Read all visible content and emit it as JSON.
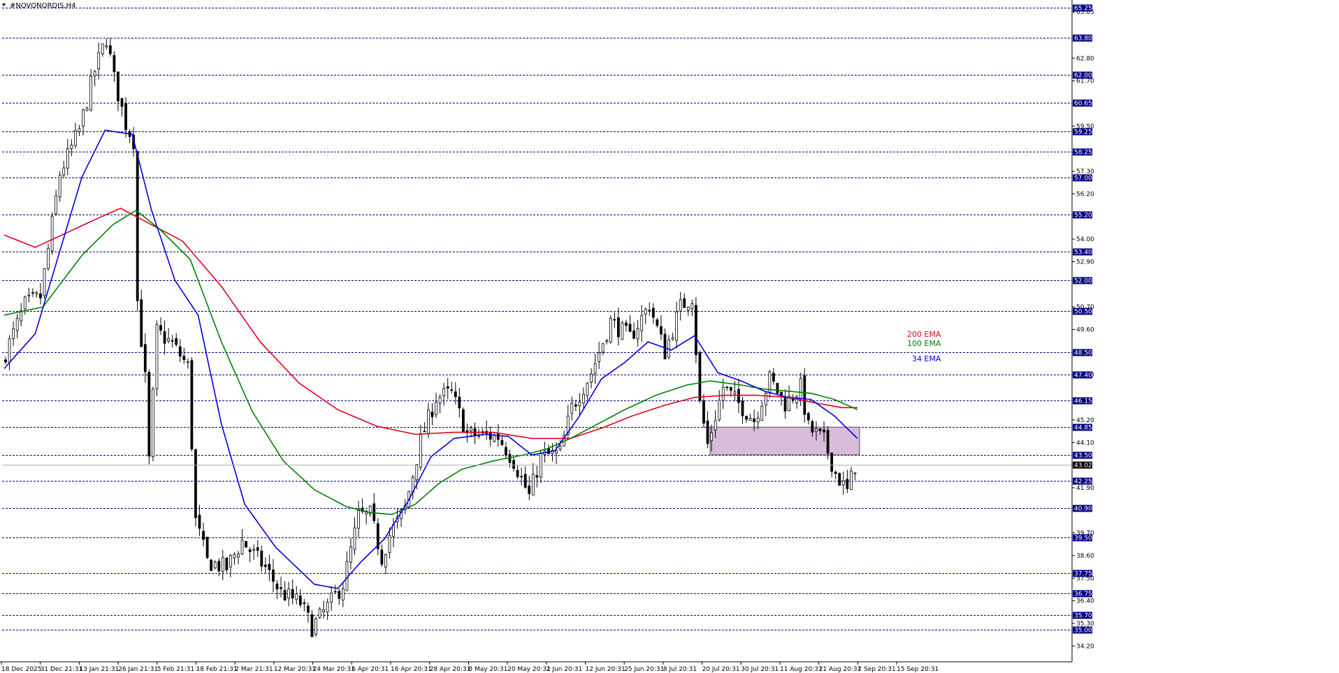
{
  "window": {
    "title": "#NOVONORDIS,H4"
  },
  "chart_data": {
    "type": "candlestick",
    "symbol": "#NOVONORDIS",
    "timeframe": "H4",
    "ylim": [
      33.6,
      65.5
    ],
    "grid": "horizontal dashed at marked levels",
    "price_ticks": [
      65.05,
      62.8,
      61.7,
      59.5,
      57.3,
      56.2,
      54.0,
      52.9,
      50.7,
      49.6,
      47.4,
      45.2,
      44.1,
      41.9,
      39.7,
      38.6,
      37.5,
      36.4,
      35.3,
      34.2
    ],
    "levels": [
      {
        "value": 65.25,
        "label": "65.25"
      },
      {
        "value": 63.8,
        "label": "63.80"
      },
      {
        "value": 62.0,
        "label": "62.00"
      },
      {
        "value": 60.65,
        "label": "60.65"
      },
      {
        "value": 59.25,
        "label": "59.25"
      },
      {
        "value": 58.25,
        "label": "58.25"
      },
      {
        "value": 57.0,
        "label": "57.00"
      },
      {
        "value": 55.2,
        "label": "55.20"
      },
      {
        "value": 53.4,
        "label": "53.40"
      },
      {
        "value": 52.0,
        "label": "52.00"
      },
      {
        "value": 50.5,
        "label": "50.50"
      },
      {
        "value": 48.5,
        "label": "48.50"
      },
      {
        "value": 47.4,
        "label": "47.40"
      },
      {
        "value": 46.15,
        "label": "46.15"
      },
      {
        "value": 44.85,
        "label": "44.85"
      },
      {
        "value": 43.5,
        "label": "43.50"
      },
      {
        "value": 42.25,
        "label": "42.25"
      },
      {
        "value": 40.9,
        "label": "40.90"
      },
      {
        "value": 39.5,
        "label": "39.50"
      },
      {
        "value": 37.75,
        "label": "37.75"
      },
      {
        "value": 36.75,
        "label": "36.75"
      },
      {
        "value": 35.7,
        "label": "35.70"
      },
      {
        "value": 35.0,
        "label": "35.00"
      }
    ],
    "current_price": {
      "value": 43.02,
      "label": "43.02"
    },
    "time_labels": [
      "18 Dec 2025",
      "31 Dec 21:31",
      "13 Jan 21:31",
      "26 Jan 21:31",
      "5 Feb 21:31",
      "18 Feb 21:31",
      "2 Mar 21:31",
      "12 Mar 20:31",
      "24 Mar 20:31",
      "6 Apr 20:31",
      "16 Apr 20:31",
      "28 Apr 20:31",
      "8 May 20:31",
      "20 May 20:31",
      "2 Jun 20:31",
      "12 Jun 20:31",
      "25 Jun 20:31",
      "8 Jul 20:31",
      "20 Jul 20:31",
      "30 Jul 20:31",
      "11 Aug 20:31",
      "21 Aug 20:31",
      "2 Sep 20:31",
      "15 Sep 20:31"
    ],
    "bars_count": 220,
    "price_path": [
      [
        0,
        48.0
      ],
      [
        6,
        50.8
      ],
      [
        10,
        51.2
      ],
      [
        12,
        53.5
      ],
      [
        15,
        57.2
      ],
      [
        20,
        59.3
      ],
      [
        24,
        62.2
      ],
      [
        27,
        63.8
      ],
      [
        29,
        61.8
      ],
      [
        32,
        59.6
      ],
      [
        34,
        58.8
      ],
      [
        35,
        51.0
      ],
      [
        37,
        47.2
      ],
      [
        38,
        43.2
      ],
      [
        40,
        49.5
      ],
      [
        44,
        48.9
      ],
      [
        48,
        47.8
      ],
      [
        50,
        40.3
      ],
      [
        53,
        38.3
      ],
      [
        58,
        38.0
      ],
      [
        62,
        39.3
      ],
      [
        68,
        38.0
      ],
      [
        72,
        36.8
      ],
      [
        77,
        36.3
      ],
      [
        80,
        35.1
      ],
      [
        84,
        36.1
      ],
      [
        88,
        37.2
      ],
      [
        92,
        40.5
      ],
      [
        95,
        40.6
      ],
      [
        98,
        38.5
      ],
      [
        100,
        39.6
      ],
      [
        104,
        40.9
      ],
      [
        108,
        44.2
      ],
      [
        112,
        46.3
      ],
      [
        116,
        46.5
      ],
      [
        120,
        44.5
      ],
      [
        128,
        44.4
      ],
      [
        132,
        43.2
      ],
      [
        136,
        41.5
      ],
      [
        139,
        43.4
      ],
      [
        144,
        43.6
      ],
      [
        147,
        45.8
      ],
      [
        152,
        47.5
      ],
      [
        157,
        50.0
      ],
      [
        162,
        49.2
      ],
      [
        167,
        50.8
      ],
      [
        171,
        48.5
      ],
      [
        175,
        50.7
      ],
      [
        178,
        51.2
      ],
      [
        180,
        46.0
      ],
      [
        182,
        44.0
      ],
      [
        186,
        46.8
      ],
      [
        190,
        46.0
      ],
      [
        194,
        45.2
      ],
      [
        198,
        47.2
      ],
      [
        202,
        46.0
      ],
      [
        206,
        46.8
      ],
      [
        208,
        44.8
      ],
      [
        212,
        44.2
      ],
      [
        215,
        42.6
      ],
      [
        218,
        41.7
      ],
      [
        220,
        43.0
      ]
    ],
    "ema_path_points": {
      "ema34": [
        [
          0,
          47.7
        ],
        [
          8,
          49.4
        ],
        [
          14,
          53.2
        ],
        [
          20,
          57.0
        ],
        [
          26,
          59.3
        ],
        [
          33,
          59.1
        ],
        [
          38,
          55.4
        ],
        [
          44,
          52.0
        ],
        [
          50,
          50.3
        ],
        [
          56,
          45.0
        ],
        [
          62,
          41.1
        ],
        [
          70,
          39.0
        ],
        [
          80,
          37.2
        ],
        [
          86,
          37.0
        ],
        [
          92,
          38.3
        ],
        [
          98,
          39.4
        ],
        [
          104,
          41.2
        ],
        [
          110,
          43.4
        ],
        [
          116,
          44.3
        ],
        [
          124,
          44.5
        ],
        [
          130,
          44.4
        ],
        [
          136,
          43.5
        ],
        [
          142,
          43.7
        ],
        [
          148,
          45.3
        ],
        [
          154,
          47.2
        ],
        [
          160,
          48.0
        ],
        [
          166,
          49.0
        ],
        [
          172,
          48.6
        ],
        [
          178,
          49.3
        ],
        [
          184,
          47.5
        ],
        [
          190,
          47.1
        ],
        [
          196,
          46.6
        ],
        [
          202,
          46.3
        ],
        [
          208,
          46.2
        ],
        [
          214,
          45.4
        ],
        [
          220,
          44.3
        ]
      ],
      "ema100": [
        [
          0,
          50.3
        ],
        [
          10,
          50.7
        ],
        [
          20,
          53.2
        ],
        [
          28,
          54.7
        ],
        [
          34,
          55.4
        ],
        [
          40,
          54.5
        ],
        [
          48,
          53.0
        ],
        [
          56,
          49.0
        ],
        [
          64,
          45.6
        ],
        [
          72,
          43.2
        ],
        [
          80,
          41.8
        ],
        [
          88,
          41.0
        ],
        [
          94,
          40.7
        ],
        [
          100,
          40.6
        ],
        [
          106,
          41.1
        ],
        [
          112,
          42.1
        ],
        [
          118,
          42.8
        ],
        [
          126,
          43.2
        ],
        [
          134,
          43.5
        ],
        [
          140,
          43.8
        ],
        [
          146,
          44.3
        ],
        [
          154,
          45.1
        ],
        [
          160,
          45.7
        ],
        [
          168,
          46.4
        ],
        [
          176,
          46.9
        ],
        [
          182,
          47.1
        ],
        [
          190,
          46.9
        ],
        [
          196,
          46.7
        ],
        [
          202,
          46.6
        ],
        [
          208,
          46.5
        ],
        [
          214,
          46.2
        ],
        [
          220,
          45.7
        ]
      ],
      "ema200": [
        [
          0,
          54.2
        ],
        [
          8,
          53.6
        ],
        [
          16,
          54.3
        ],
        [
          24,
          55.0
        ],
        [
          30,
          55.5
        ],
        [
          38,
          54.7
        ],
        [
          46,
          53.9
        ],
        [
          56,
          51.7
        ],
        [
          66,
          49.0
        ],
        [
          76,
          47.0
        ],
        [
          86,
          45.7
        ],
        [
          96,
          44.9
        ],
        [
          106,
          44.5
        ],
        [
          116,
          44.6
        ],
        [
          126,
          44.6
        ],
        [
          136,
          44.3
        ],
        [
          146,
          44.3
        ],
        [
          154,
          44.8
        ],
        [
          162,
          45.4
        ],
        [
          170,
          45.9
        ],
        [
          178,
          46.3
        ],
        [
          186,
          46.4
        ],
        [
          194,
          46.4
        ],
        [
          202,
          46.3
        ],
        [
          210,
          46.0
        ],
        [
          216,
          45.8
        ],
        [
          220,
          45.8
        ]
      ]
    },
    "series": [
      {
        "name": "200 EMA",
        "color": "#e00020"
      },
      {
        "name": "100 EMA",
        "color": "#008000"
      },
      {
        "name": "34 EMA",
        "color": "#0000e0"
      }
    ],
    "zone": {
      "x_range_bars": [
        182,
        220
      ],
      "y_range": [
        43.5,
        44.85
      ],
      "color": "#d8bcd9"
    }
  }
}
